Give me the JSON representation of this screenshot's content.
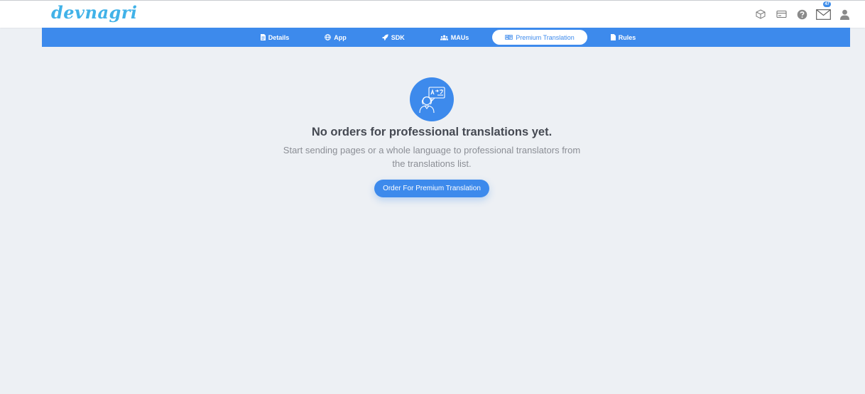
{
  "header": {
    "logo": "devnagri",
    "icons": [
      "cube-icon",
      "card-icon",
      "help-icon",
      "mail-icon",
      "user-icon"
    ],
    "mail_badge": "47"
  },
  "tabs": [
    {
      "label": "Details",
      "icon": "document-icon"
    },
    {
      "label": "App",
      "icon": "globe-icon"
    },
    {
      "label": "SDK",
      "icon": "rocket-icon"
    },
    {
      "label": "MAUs",
      "icon": "users-icon"
    },
    {
      "label": "Premium Translation",
      "icon": "translate-icon",
      "active": true
    },
    {
      "label": "Rules",
      "icon": "file-icon"
    }
  ],
  "empty_state": {
    "icon": "translator-icon",
    "title": "No orders for professional translations yet.",
    "subtitle": "Start sending pages or a whole language to professional translators from the translations list.",
    "button": "Order For Premium Translation"
  },
  "colors": {
    "accent": "#3d8aec",
    "background": "#edf0f4",
    "logo": "#41b2e8",
    "title": "#454952",
    "subtitle": "#8b8e95"
  }
}
